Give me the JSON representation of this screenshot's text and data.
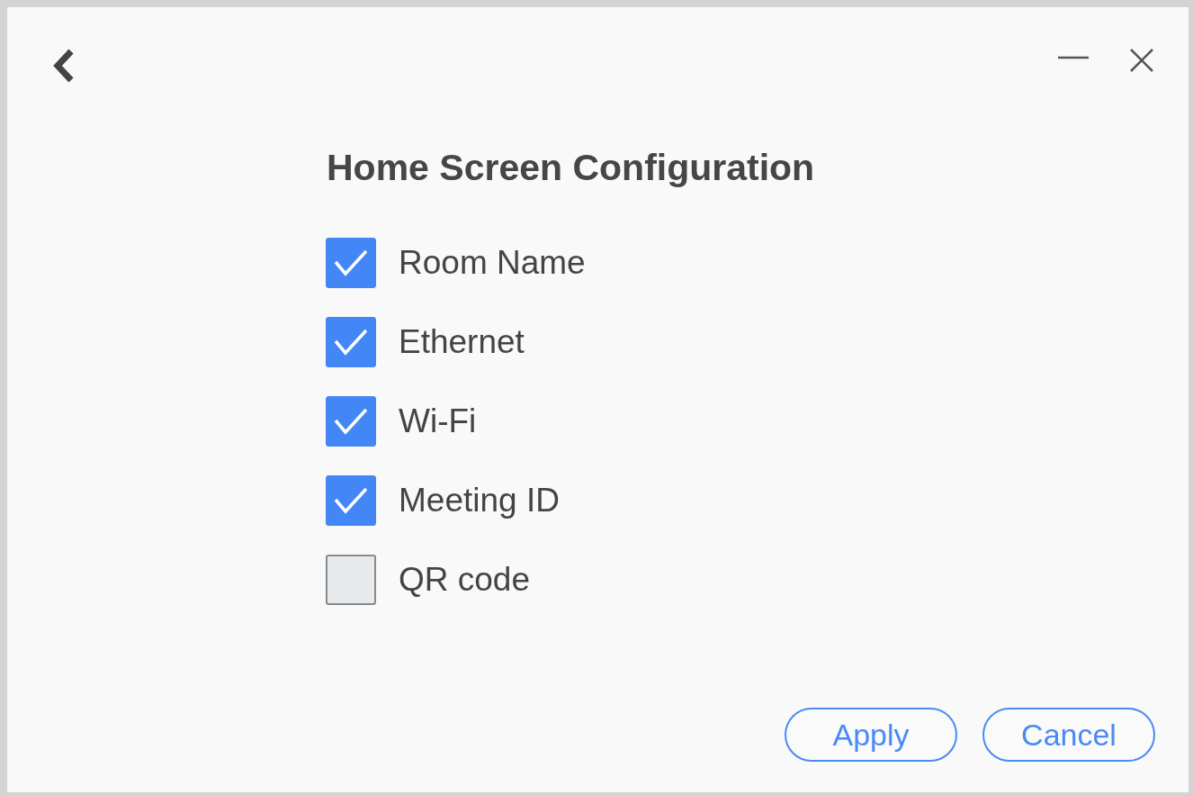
{
  "title": "Home Screen Configuration",
  "options": [
    {
      "label": "Room Name",
      "checked": true
    },
    {
      "label": "Ethernet",
      "checked": true
    },
    {
      "label": "Wi-Fi",
      "checked": true
    },
    {
      "label": "Meeting ID",
      "checked": true
    },
    {
      "label": "QR code",
      "checked": false
    }
  ],
  "buttons": [
    "Apply",
    "Cancel"
  ]
}
